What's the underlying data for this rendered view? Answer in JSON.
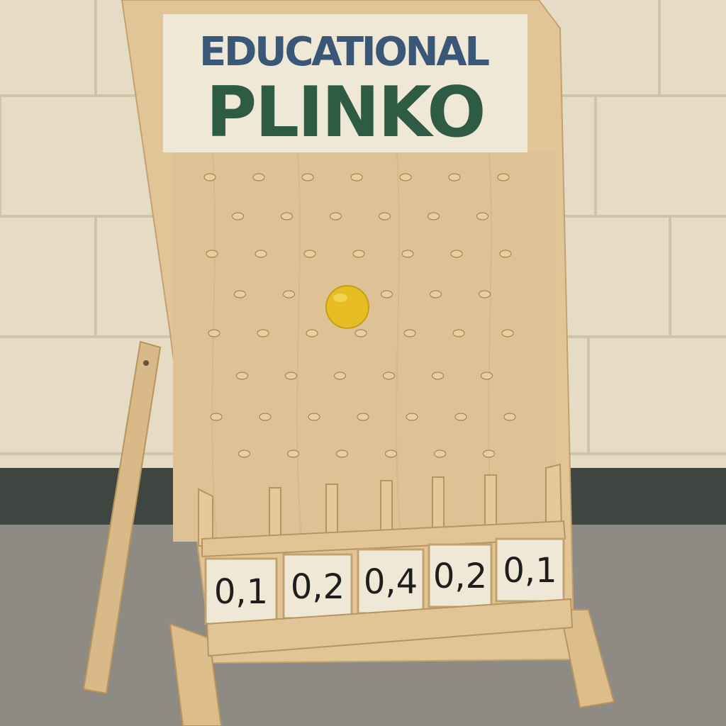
{
  "sign": {
    "line1": "EDUCATIONAL",
    "line2": "PLINKO"
  },
  "bins": [
    "0,1",
    "0,2",
    "0,4",
    "0,2",
    "0,1"
  ],
  "colors": {
    "wall": "#e6dcc6",
    "floor": "#8d8b83",
    "baseboard": "#3f4641",
    "wood": "#e2c596",
    "board": "#dfc196",
    "sign_bg": "#efe8d6",
    "title_blue": "#3b5777",
    "title_green": "#2e5b44",
    "ball": "#e6bd22"
  }
}
